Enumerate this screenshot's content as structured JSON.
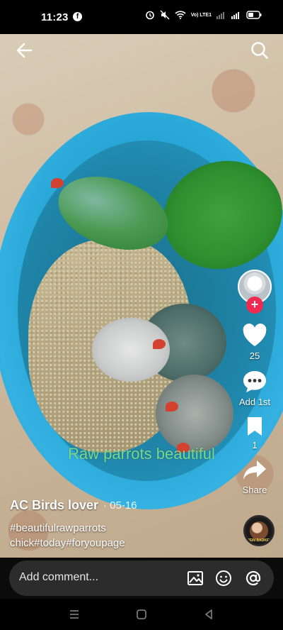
{
  "status_bar": {
    "time": "11:23",
    "network_label": "Vo) LTE1"
  },
  "video": {
    "caption_overlay": "Raw parrots beautiful"
  },
  "rail": {
    "like_count": "25",
    "comment_label": "Add 1st",
    "save_count": "1",
    "share_label": "Share"
  },
  "post": {
    "author": "AC Birds lover",
    "date": "· 05-16",
    "description": "#beautifulrawparrots chick#today#foryoupage",
    "sound_disc_text": "MEIN BADKEY"
  },
  "comment_bar": {
    "placeholder": "Add comment..."
  },
  "colors": {
    "like_red": "#ef2950",
    "caption_green": "#7bd68a",
    "bucket_blue": "#2aa8d8"
  },
  "icons": [
    "back-arrow-icon",
    "search-icon",
    "heart-icon",
    "comment-icon",
    "bookmark-icon",
    "share-icon",
    "image-icon",
    "emoji-icon",
    "at-icon",
    "nav-menu-icon",
    "nav-home-icon",
    "nav-back-icon"
  ]
}
